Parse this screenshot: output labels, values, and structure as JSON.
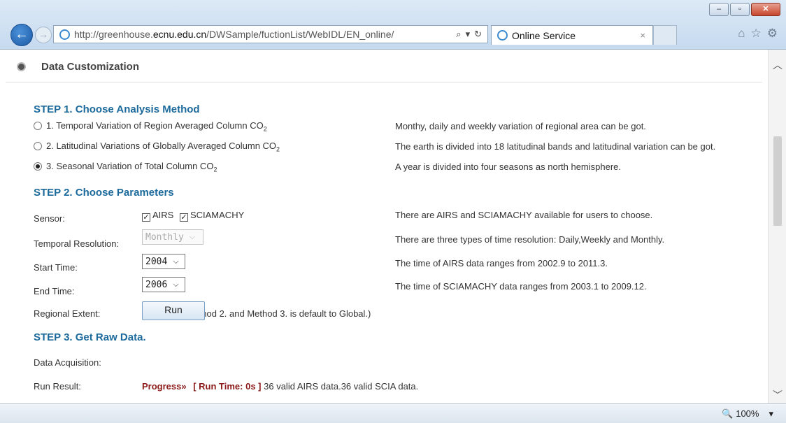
{
  "window": {
    "minimize": "–",
    "maximize": "▫",
    "close": "✕"
  },
  "nav": {
    "back": "←",
    "forward": "→"
  },
  "address_bar": {
    "url_prefix": "http://greenhouse.",
    "url_domain": "ecnu.edu.cn",
    "url_suffix": "/DWSample/fuctionList/WebIDL/EN_online/",
    "search_icon": "⌕",
    "dropdown_icon": "▾",
    "refresh_icon": "↻"
  },
  "tab": {
    "label": "Online Service",
    "close": "×"
  },
  "toolbar_icons": {
    "home": "⌂",
    "favorites": "☆",
    "settings": "⚙"
  },
  "section": {
    "title": "Data Customization"
  },
  "step1": {
    "title": "STEP 1. Choose Analysis Method",
    "options": [
      {
        "label": "1. Temporal Variation of Region Averaged Column CO",
        "sub": "2",
        "checked": false,
        "desc": "Monthy, daily and weekly variation of regional area can be got."
      },
      {
        "label": "2. Latitudinal Variations of Globally Averaged Column CO",
        "sub": "2",
        "checked": false,
        "desc": "The earth is divided into 18 latitudinal bands and latitudinal variation can be got."
      },
      {
        "label": "3. Seasonal Variation of Total Column CO",
        "sub": "2",
        "checked": true,
        "desc": "A year is divided into four seasons as north hemisphere."
      }
    ]
  },
  "step2": {
    "title": "STEP 2. Choose Parameters",
    "sensor": {
      "label": "Sensor:",
      "airs": "AIRS",
      "sciamachy": "SCIAMACHY",
      "check": "✓",
      "desc": "There are AIRS and SCIAMACHY available for users to choose."
    },
    "temporal": {
      "label": "Temporal Resolution:",
      "value": "Monthly",
      "desc": "There are three types of time resolution: Daily,Weekly and Monthly."
    },
    "start": {
      "label": "Start Time:",
      "value": "2004",
      "desc": "The time of AIRS data ranges from 2002.9 to 2011.3."
    },
    "end": {
      "label": "End Time:",
      "value": "2006",
      "desc": "The time of SCIAMACHY data ranges from 2003.1 to 2009.12."
    },
    "region": {
      "label": "Regional Extent:",
      "value": "(Region of Method 2. and Method 3. is default to Global.)"
    },
    "select_arrow": "❯"
  },
  "step3": {
    "title": "STEP 3. Get Raw Data.",
    "acquisition_label": "Data Acquisition:",
    "run_button": "Run",
    "result_label": "Run Result:",
    "progress": "Progress»",
    "run_time": "[ Run Time: 0s ]",
    "result_text": "36 valid AIRS data.36 valid SCIA data."
  },
  "scrollbar": {
    "up": "︿",
    "down": "﹀"
  },
  "statusbar": {
    "zoom": "100%",
    "zoom_icon": "🔍",
    "dropdown": "▾"
  }
}
